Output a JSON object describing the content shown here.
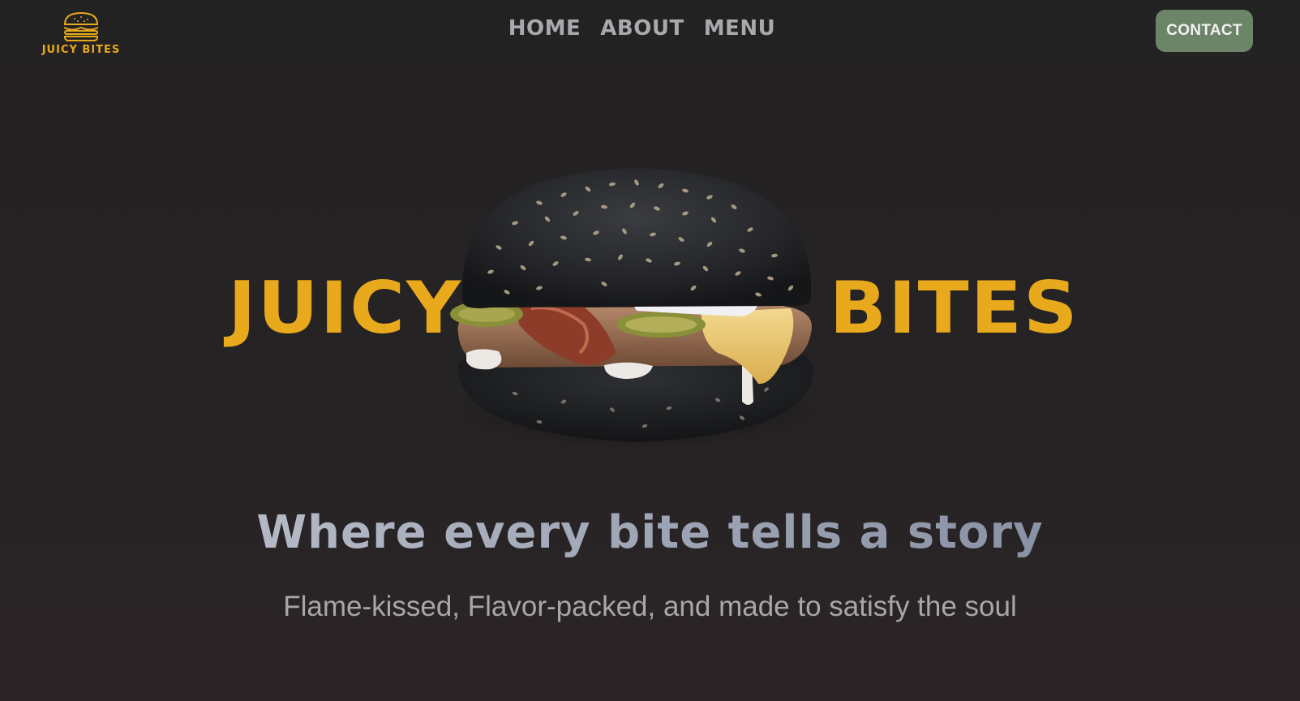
{
  "header": {
    "logo": {
      "icon": "burger-icon",
      "text": "JUICY BITES",
      "color": "#e8a91c"
    },
    "nav": [
      {
        "label": "HOME"
      },
      {
        "label": "ABOUT"
      },
      {
        "label": "MENU"
      }
    ],
    "contact_label": "CONTACT",
    "contact_color": "#6c8468"
  },
  "hero": {
    "word_left": "JUICY",
    "word_right": "BITES",
    "accent_color": "#e8a91c",
    "image": "black-bun-sesame-burger-image"
  },
  "tagline": "Where every bite tells a story",
  "subline": "Flame-kissed, Flavor-packed, and made to satisfy the soul"
}
